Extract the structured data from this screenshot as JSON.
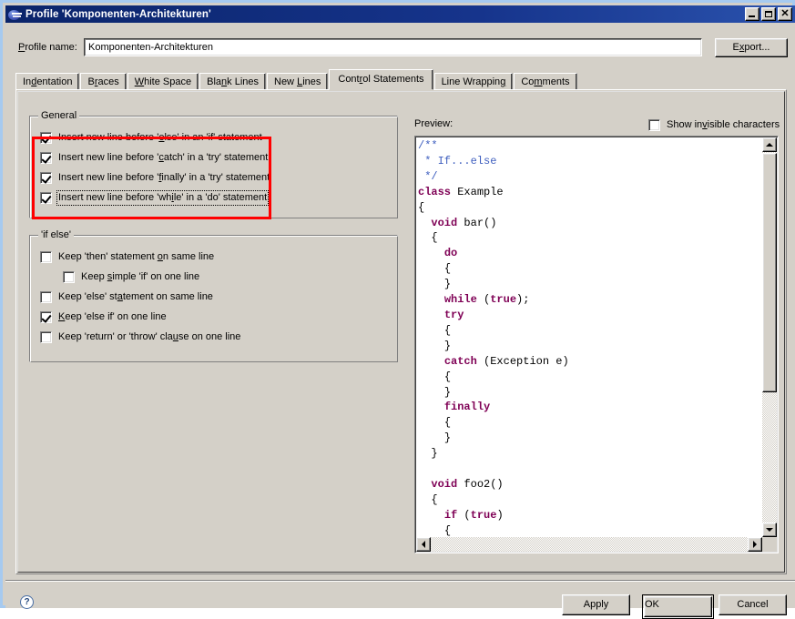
{
  "window": {
    "title": "Profile 'Komponenten-Architekturen'",
    "icon": "eclipse-icon",
    "minimize_label": "_",
    "maximize_label": "□",
    "close_label": "✕"
  },
  "profile": {
    "label": "Profile name:",
    "label_mnemonic": "P",
    "value": "Komponenten-Architekturen",
    "export_label": "Export...",
    "export_mnemonic": "x"
  },
  "tabs": [
    {
      "label": "Indentation",
      "pre": "In",
      "mn": "d",
      "post": "entation",
      "selected": false
    },
    {
      "label": "Braces",
      "pre": "B",
      "mn": "r",
      "post": "aces",
      "selected": false
    },
    {
      "label": "White Space",
      "pre": "",
      "mn": "W",
      "post": "hite Space",
      "selected": false
    },
    {
      "label": "Blank Lines",
      "pre": "Bla",
      "mn": "n",
      "post": "k Lines",
      "selected": false
    },
    {
      "label": "New Lines",
      "pre": "New ",
      "mn": "L",
      "post": "ines",
      "selected": false
    },
    {
      "label": "Control Statements",
      "pre": "Cont",
      "mn": "r",
      "post": "ol Statements",
      "selected": true
    },
    {
      "label": "Line Wrapping",
      "pre": "Line Wrappin",
      "mn": "g",
      "post": "",
      "selected": false
    },
    {
      "label": "Comments",
      "pre": "Co",
      "mn": "m",
      "post": "ments",
      "selected": false
    }
  ],
  "general_group": {
    "title": "General",
    "items": [
      {
        "pre": "Insert new line before '",
        "mn": "e",
        "post": "lse' in an 'if' statement",
        "checked": true,
        "focused": false
      },
      {
        "pre": "Insert new line before '",
        "mn": "c",
        "post": "atch' in a 'try' statement",
        "checked": true,
        "focused": false
      },
      {
        "pre": "Insert new line before '",
        "mn": "f",
        "post": "inally' in a 'try' statement",
        "checked": true,
        "focused": false
      },
      {
        "pre": "Insert new line before 'wh",
        "mn": "i",
        "post": "le' in a 'do' statement",
        "checked": true,
        "focused": true
      }
    ]
  },
  "ifelse_group": {
    "title": "'if else'",
    "items": [
      {
        "pre": "Keep 'then' statement ",
        "mn": "o",
        "post": "n same line",
        "checked": false,
        "indent": false
      },
      {
        "pre": "Keep ",
        "mn": "s",
        "post": "imple 'if' on one line",
        "checked": false,
        "indent": true
      },
      {
        "pre": "Keep 'else' st",
        "mn": "a",
        "post": "tement on same line",
        "checked": false,
        "indent": false
      },
      {
        "pre": "",
        "mn": "K",
        "post": "eep 'else if' on one line",
        "checked": true,
        "indent": false
      },
      {
        "pre": "Keep 'return' or 'throw' cla",
        "mn": "u",
        "post": "se on one line",
        "checked": false,
        "indent": false
      }
    ]
  },
  "preview": {
    "label": "Preview:",
    "show_invisible": {
      "pre": "Show in",
      "mn": "v",
      "post": "isible characters",
      "checked": false
    },
    "code_lines": [
      {
        "indent": 0,
        "parts": [
          {
            "t": "/**",
            "c": "cmt"
          }
        ]
      },
      {
        "indent": 0,
        "parts": [
          {
            "t": " * If...else",
            "c": "cmt"
          }
        ]
      },
      {
        "indent": 0,
        "parts": [
          {
            "t": " */",
            "c": "cmt"
          }
        ]
      },
      {
        "indent": 0,
        "parts": [
          {
            "t": "class",
            "c": "kw"
          },
          {
            "t": " Example",
            "c": ""
          }
        ]
      },
      {
        "indent": 0,
        "parts": [
          {
            "t": "{",
            "c": ""
          }
        ]
      },
      {
        "indent": 1,
        "parts": [
          {
            "t": "void",
            "c": "kw"
          },
          {
            "t": " bar()",
            "c": ""
          }
        ]
      },
      {
        "indent": 1,
        "parts": [
          {
            "t": "{",
            "c": ""
          }
        ]
      },
      {
        "indent": 2,
        "parts": [
          {
            "t": "do",
            "c": "kw"
          }
        ]
      },
      {
        "indent": 2,
        "parts": [
          {
            "t": "{",
            "c": ""
          }
        ]
      },
      {
        "indent": 2,
        "parts": [
          {
            "t": "}",
            "c": ""
          }
        ]
      },
      {
        "indent": 2,
        "parts": [
          {
            "t": "while",
            "c": "kw"
          },
          {
            "t": " (",
            "c": ""
          },
          {
            "t": "true",
            "c": "kw"
          },
          {
            "t": ");",
            "c": ""
          }
        ]
      },
      {
        "indent": 2,
        "parts": [
          {
            "t": "try",
            "c": "kw"
          }
        ]
      },
      {
        "indent": 2,
        "parts": [
          {
            "t": "{",
            "c": ""
          }
        ]
      },
      {
        "indent": 2,
        "parts": [
          {
            "t": "}",
            "c": ""
          }
        ]
      },
      {
        "indent": 2,
        "parts": [
          {
            "t": "catch",
            "c": "kw"
          },
          {
            "t": " (Exception e)",
            "c": ""
          }
        ]
      },
      {
        "indent": 2,
        "parts": [
          {
            "t": "{",
            "c": ""
          }
        ]
      },
      {
        "indent": 2,
        "parts": [
          {
            "t": "}",
            "c": ""
          }
        ]
      },
      {
        "indent": 2,
        "parts": [
          {
            "t": "finally",
            "c": "kw"
          }
        ]
      },
      {
        "indent": 2,
        "parts": [
          {
            "t": "{",
            "c": ""
          }
        ]
      },
      {
        "indent": 2,
        "parts": [
          {
            "t": "}",
            "c": ""
          }
        ]
      },
      {
        "indent": 1,
        "parts": [
          {
            "t": "}",
            "c": ""
          }
        ]
      },
      {
        "indent": 0,
        "parts": [
          {
            "t": "",
            "c": ""
          }
        ]
      },
      {
        "indent": 1,
        "parts": [
          {
            "t": "void",
            "c": "kw"
          },
          {
            "t": " foo2()",
            "c": ""
          }
        ]
      },
      {
        "indent": 1,
        "parts": [
          {
            "t": "{",
            "c": ""
          }
        ]
      },
      {
        "indent": 2,
        "parts": [
          {
            "t": "if",
            "c": "kw"
          },
          {
            "t": " (",
            "c": ""
          },
          {
            "t": "true",
            "c": "kw"
          },
          {
            "t": ")",
            "c": ""
          }
        ]
      },
      {
        "indent": 2,
        "parts": [
          {
            "t": "{",
            "c": ""
          }
        ]
      }
    ]
  },
  "footer": {
    "help_label": "?",
    "apply_label": "Apply",
    "ok_label": "OK",
    "cancel_label": "Cancel"
  },
  "colors": {
    "titlebar": "#0a246a",
    "face": "#d4d0c8",
    "frame": "#a6caf0",
    "annotation": "#ff0000",
    "comment": "#3f5fbf",
    "keyword": "#7f0055"
  }
}
